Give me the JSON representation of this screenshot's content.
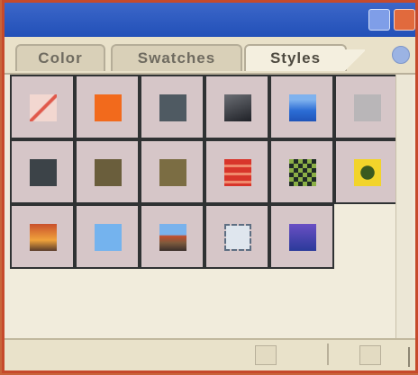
{
  "tabs": [
    {
      "label": "Color"
    },
    {
      "label": "Swatches"
    },
    {
      "label": "Styles"
    }
  ],
  "active_tab": "Styles",
  "styles": [
    {
      "name": "none-style-icon",
      "fill": "linear-gradient(135deg,#f2d7d0 45%,#e0584a 48%,#e0584a 54%,#f2d7d0 57%)"
    },
    {
      "name": "orange-square-style-icon",
      "fill": "#f26a1c"
    },
    {
      "name": "slate-style-icon",
      "fill": "#4f5a62"
    },
    {
      "name": "dark-bevel-style-icon",
      "fill": "linear-gradient(160deg,#6b6e74,#1f2127)"
    },
    {
      "name": "blue-wave-style-icon",
      "fill": "linear-gradient(180deg,#7fb2ee 20%,#2c6dd5 60%,#1f54b9)"
    },
    {
      "name": "faded-gray-style-icon",
      "fill": "#b9b6b8"
    },
    {
      "name": "charcoal-style-icon",
      "fill": "#3c4348"
    },
    {
      "name": "olive-style-icon",
      "fill": "#6a5e3c"
    },
    {
      "name": "khaki-style-icon",
      "fill": "#7b6d43"
    },
    {
      "name": "red-stripes-style-icon",
      "fill": "repeating-linear-gradient(180deg,#d8352b 0 6px,#f08a6d 6px 9px)"
    },
    {
      "name": "checker-pattern-style-icon",
      "fill": "repeating-conic-gradient(#1f2b26 0 25%,#8bb046 0 50%) 0 0/10px 10px"
    },
    {
      "name": "yellow-frame-style-icon",
      "fill": "radial-gradient(circle,#3b5a1f 35%,#f2d42a 38%)"
    },
    {
      "name": "sunset-gradient-style-icon",
      "fill": "linear-gradient(180deg,#c9502c,#f0a23b 60%,#5a3b2a)"
    },
    {
      "name": "light-blue-style-icon",
      "fill": "#74b3ee"
    },
    {
      "name": "landscape-style-icon",
      "fill": "linear-gradient(180deg,#79b2ec 40%,#c24e2d 45%,#7d5a3d 70%,#3b2f2a)"
    },
    {
      "name": "outline-frame-style-icon",
      "fill": "linear-gradient(#dfe6ee,#dfe6ee) padding-box"
    },
    {
      "name": "purple-glow-style-icon",
      "fill": "linear-gradient(180deg,#6a4fc4,#2a3a9a)"
    }
  ]
}
